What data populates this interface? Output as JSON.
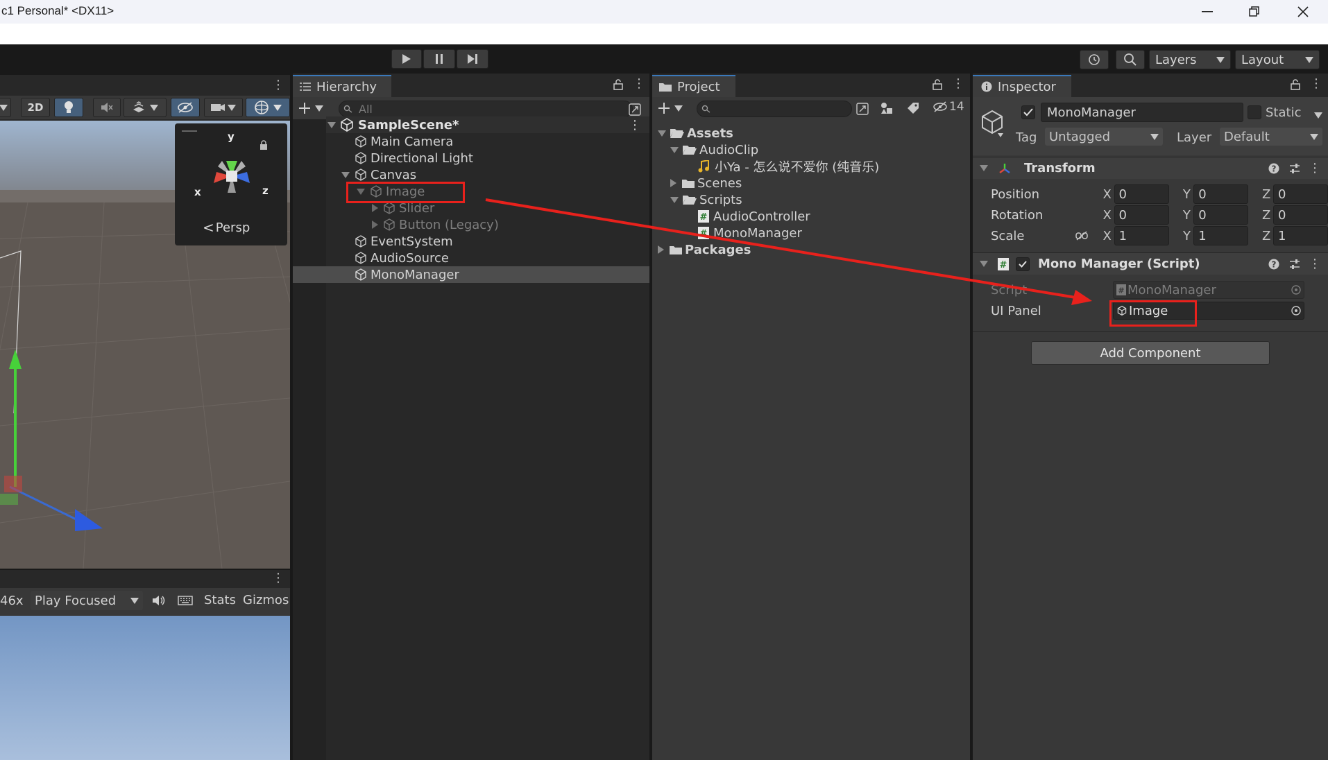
{
  "window": {
    "title": "c1 Personal* <DX11>",
    "controls": {
      "minimize": "—",
      "maximize": "❐",
      "close": "✕"
    }
  },
  "toolbar": {
    "layers_label": "Layers",
    "layout_label": "Layout"
  },
  "scene_view": {
    "toggle_2d": "2D",
    "gizmo": {
      "y": "y",
      "x": "x",
      "z": "z",
      "persp": "Persp"
    }
  },
  "game_view": {
    "scale": "46x",
    "play_mode": "Play Focused",
    "stats": "Stats",
    "gizmos": "Gizmos"
  },
  "hierarchy": {
    "tab_label": "Hierarchy",
    "search_placeholder": "All",
    "scene_name": "SampleScene*",
    "items": [
      {
        "label": "Main Camera"
      },
      {
        "label": "Directional Light"
      },
      {
        "label": "Canvas"
      },
      {
        "label": "Image"
      },
      {
        "label": "Slider"
      },
      {
        "label": "Button (Legacy)"
      },
      {
        "label": "EventSystem"
      },
      {
        "label": "AudioSource"
      },
      {
        "label": "MonoManager"
      }
    ]
  },
  "project": {
    "tab_label": "Project",
    "hidden_count": "14",
    "tree": [
      {
        "label": "Assets"
      },
      {
        "label": "AudioClip"
      },
      {
        "label": "小Ya - 怎么说不爱你 (纯音乐)"
      },
      {
        "label": "Scenes"
      },
      {
        "label": "Scripts"
      },
      {
        "label": "AudioController"
      },
      {
        "label": "MonoManager"
      },
      {
        "label": "Packages"
      }
    ]
  },
  "inspector": {
    "tab_label": "Inspector",
    "object_name": "MonoManager",
    "static_label": "Static",
    "tag_label": "Tag",
    "tag_value": "Untagged",
    "layer_label": "Layer",
    "layer_value": "Default",
    "transform": {
      "title": "Transform",
      "position": {
        "label": "Position",
        "x": "0",
        "y": "0",
        "z": "0"
      },
      "rotation": {
        "label": "Rotation",
        "x": "0",
        "y": "0",
        "z": "0"
      },
      "scale": {
        "label": "Scale",
        "x": "1",
        "y": "1",
        "z": "1"
      },
      "axis_x": "X",
      "axis_y": "Y",
      "axis_z": "Z"
    },
    "mono_manager": {
      "title": "Mono Manager (Script)",
      "script_label": "Script",
      "script_value": "MonoManager",
      "ui_panel_label": "UI Panel",
      "ui_panel_value": "Image"
    },
    "add_component": "Add Component"
  },
  "annotations": {
    "highlight_color": "#e8211c"
  },
  "colors": {
    "accent": "#3a79bb",
    "panel": "#383838",
    "selection": "#4d4d4d"
  }
}
